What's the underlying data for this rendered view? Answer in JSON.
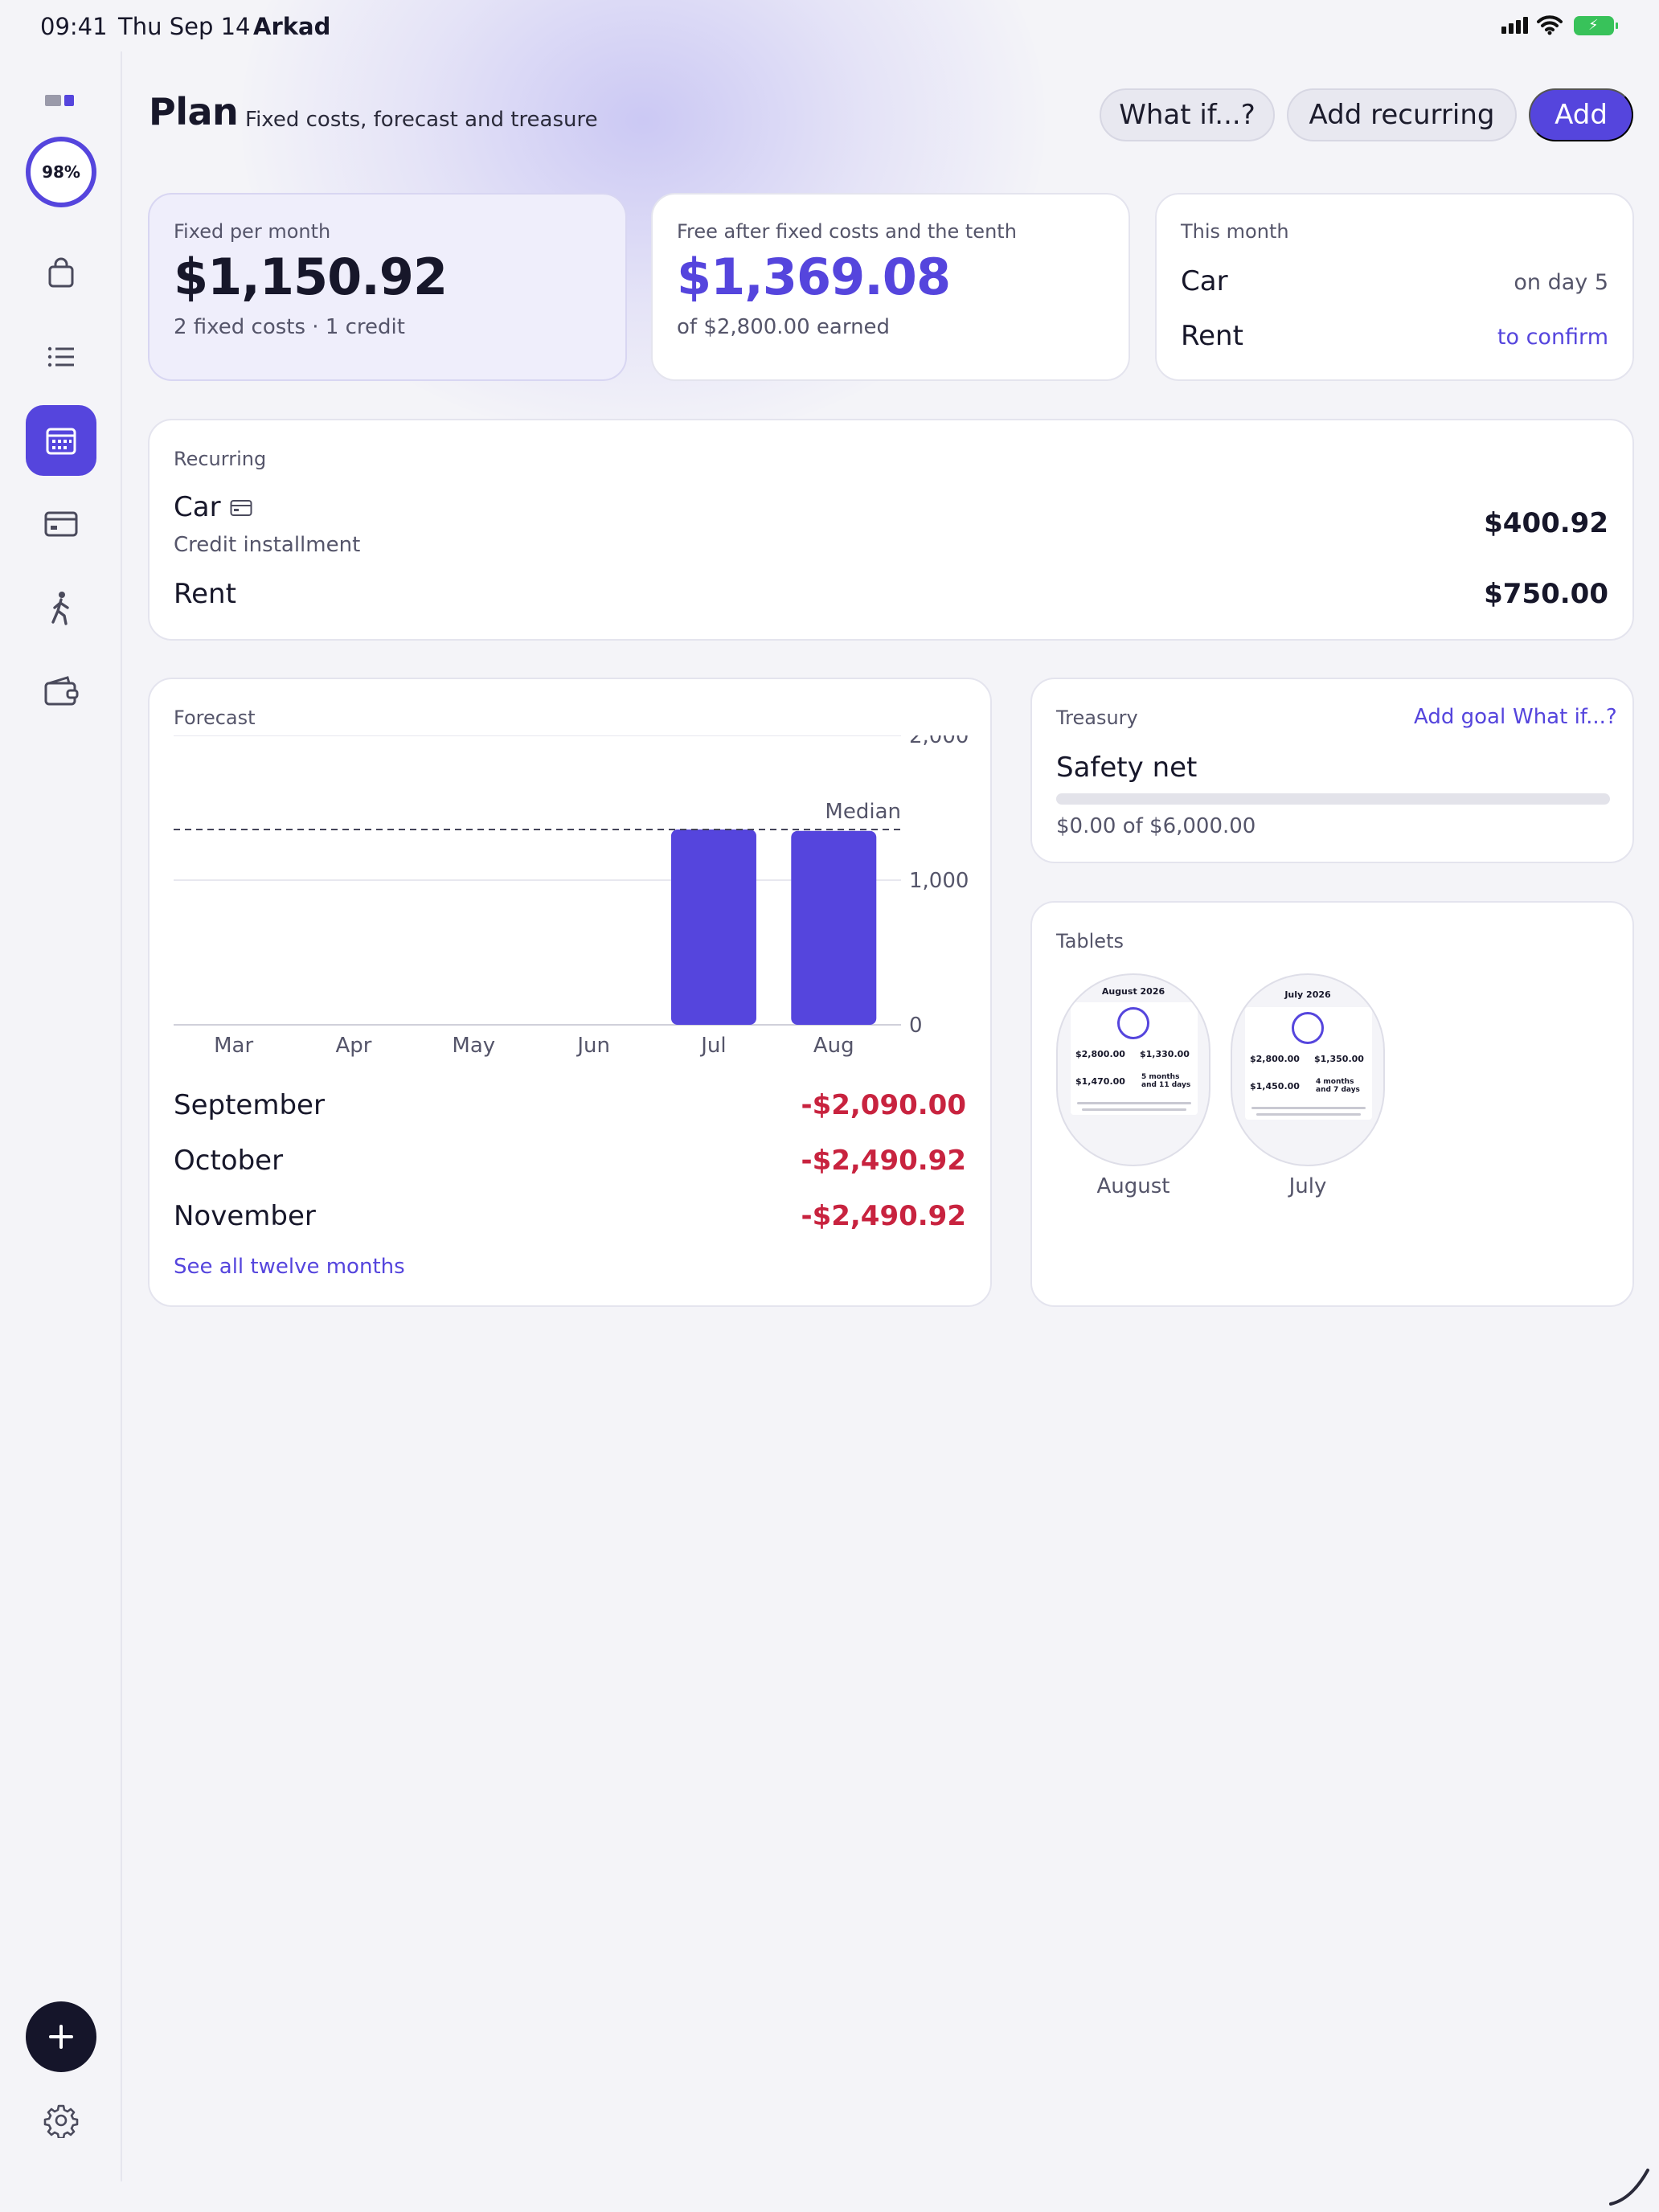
{
  "status_bar": {
    "time": "09:41",
    "date": "Thu Sep 14",
    "carrier": "Arkad"
  },
  "sidebar": {
    "progress": "98%",
    "items": [
      {
        "icon": "bag-icon"
      },
      {
        "icon": "list-icon"
      },
      {
        "icon": "calendar-icon",
        "active": true
      },
      {
        "icon": "card-icon"
      },
      {
        "icon": "walking-icon"
      },
      {
        "icon": "wallet-icon"
      }
    ],
    "fab_icon": "plus-icon",
    "settings_icon": "gear-icon"
  },
  "header": {
    "title": "Plan",
    "subtitle": "Fixed costs, forecast and treasure",
    "buttons": {
      "what_if": "What if...?",
      "add_recurring": "Add recurring",
      "add": "Add"
    }
  },
  "summary": {
    "fixed": {
      "label": "Fixed per month",
      "value": "$1,150.92",
      "sub": "2 fixed costs · 1 credit"
    },
    "free": {
      "label": "Free after fixed costs and the tenth",
      "value": "$1,369.08",
      "sub": "of $2,800.00 earned"
    },
    "this_month": {
      "label": "This month",
      "rows": [
        {
          "name": "Car",
          "status": "on day 5"
        },
        {
          "name": "Rent",
          "status": "to confirm"
        }
      ]
    }
  },
  "recurring": {
    "label": "Recurring",
    "items": [
      {
        "name": "Car",
        "detail": "Credit installment",
        "amount": "$400.92"
      },
      {
        "name": "Rent",
        "detail": "",
        "amount": "$750.00"
      }
    ]
  },
  "forecast": {
    "label": "Forecast",
    "rows": [
      {
        "month": "September",
        "amount": "-$2,090.00"
      },
      {
        "month": "October",
        "amount": "-$2,490.92"
      },
      {
        "month": "November",
        "amount": "-$2,490.92"
      }
    ],
    "see_all": "See all twelve months"
  },
  "chart_data": {
    "type": "bar",
    "categories": [
      "Mar",
      "Apr",
      "May",
      "Jun",
      "Jul",
      "Aug"
    ],
    "values": [
      0,
      0,
      0,
      0,
      1350,
      1340
    ],
    "median": 1350,
    "median_label": "Median",
    "ylim": [
      0,
      2000
    ],
    "yticks": [
      "2,000",
      "1,000",
      "0"
    ],
    "ytick_values": [
      2000,
      1000,
      0
    ],
    "bar_color": "#5545dd",
    "grid": true
  },
  "treasury": {
    "label": "Treasury",
    "add_goal": "Add goal",
    "what_if": "What if...?",
    "goal_name": "Safety net",
    "progress": 0,
    "progress_text": "$0.00 of $6,000.00"
  },
  "tablets": {
    "label": "Tablets",
    "items": [
      {
        "caption": "August",
        "month": "August 2026",
        "earned": "$2,800.00",
        "spent": "$1,330.00",
        "free": "$1,470.00",
        "streak": "5 months and 11 days"
      },
      {
        "caption": "July",
        "month": "July 2026",
        "earned": "$2,800.00",
        "spent": "$1,350.00",
        "free": "$1,450.00",
        "streak": "4 months and 7 days"
      }
    ]
  },
  "colors": {
    "accent": "#5545dd",
    "negative": "#c8233f",
    "background": "#f4f4f8"
  }
}
